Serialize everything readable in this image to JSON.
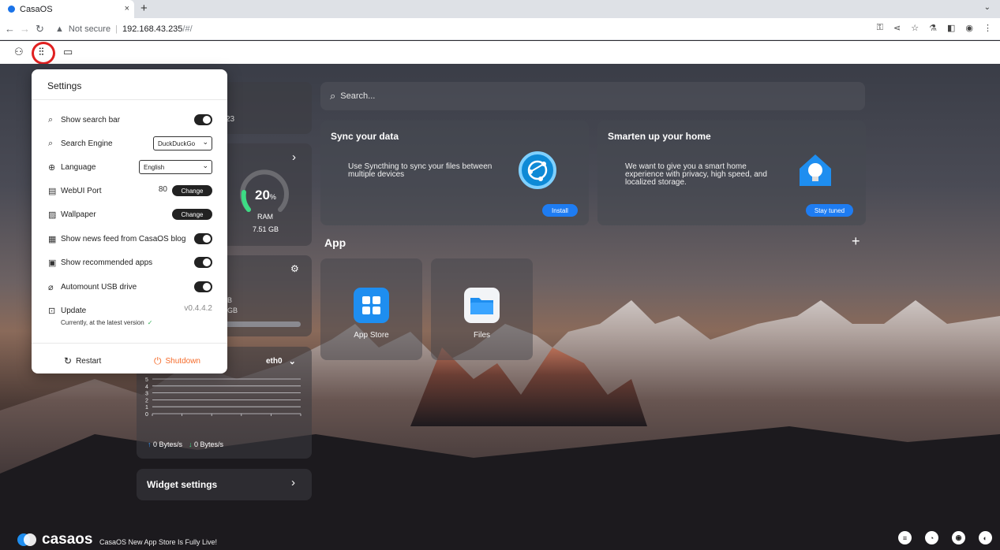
{
  "browser": {
    "tab_title": "CasaOS",
    "tab_close": "×",
    "new_tab": "+",
    "security_label": "Not secure",
    "url_host": "192.168.43.235",
    "url_path": "/#/"
  },
  "search": {
    "placeholder": "Search..."
  },
  "sync_card": {
    "title": "Sync your data",
    "text": "Use Syncthing to sync your files between multiple devices",
    "button": "Install"
  },
  "home_card": {
    "title": "Smarten up your home",
    "text": "We want to give you a smart home experience with privacy, high speed, and localized storage.",
    "button": "Stay tuned"
  },
  "apps": {
    "section_title": "App",
    "add": "+",
    "items": [
      {
        "name": "App Store",
        "icon": "app-store-icon"
      },
      {
        "name": "Files",
        "icon": "files-icon"
      }
    ]
  },
  "widgets": {
    "time_partial": "23",
    "ram": {
      "percent": "20",
      "unit": "%",
      "label": "RAM",
      "total": "7.51 GB",
      "value": 20
    },
    "storage_partial": [
      "B",
      "GB"
    ],
    "network": {
      "interface": "eth0",
      "y_ticks": [
        "5",
        "4",
        "3",
        "2",
        "1",
        "0"
      ],
      "upload": "0 Bytes/s",
      "download": "0 Bytes/s"
    },
    "widget_settings": "Widget settings"
  },
  "settings": {
    "title": "Settings",
    "rows": {
      "search_bar": "Show search bar",
      "search_engine": "Search Engine",
      "search_engine_value": "DuckDuckGo",
      "language": "Language",
      "language_value": "English",
      "webui_port": "WebUI Port",
      "port_value": "80",
      "change": "Change",
      "wallpaper": "Wallpaper",
      "news_feed": "Show news feed from CasaOS blog",
      "recommended": "Show recommended apps",
      "automount": "Automount USB drive",
      "update": "Update",
      "version": "v0.4.4.2",
      "update_status": "Currently, at the latest version"
    },
    "restart": "Restart",
    "shutdown": "Shutdown"
  },
  "footer": {
    "brand": "casaos",
    "news": "CasaOS New App Store Is Fully Live!"
  },
  "colors": {
    "accent": "#1e7cf2",
    "shutdown": "#f56b2a",
    "ram_ring": "#3ddc84"
  }
}
